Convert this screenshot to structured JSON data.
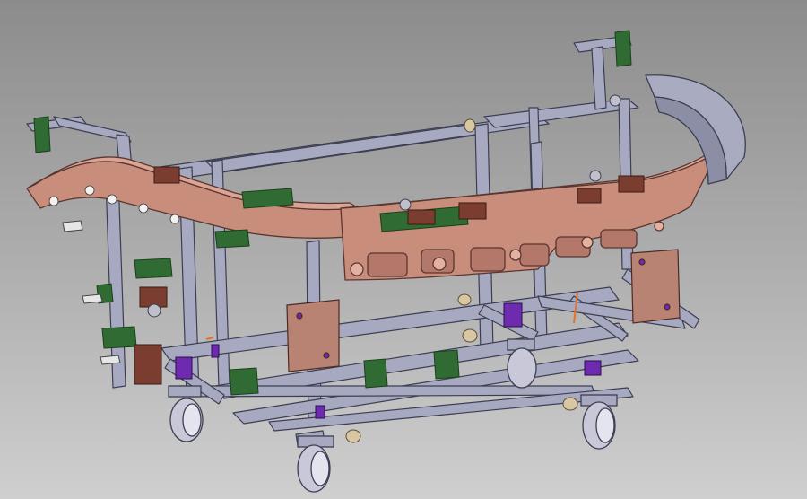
{
  "scene": {
    "background_top": "#8c8c8c",
    "background_bottom": "#cfcfcf",
    "frame_color": "#a7a9c0",
    "frame_edge": "#3c3e52",
    "part_color": "#c98d7c",
    "part_edge": "#5a3630",
    "clamp_color": "#2f6b32",
    "clamp_dark": "#1c3f1e",
    "block_color": "#7a3d2f",
    "locator_plate_color": "#b98373",
    "purple_color": "#6e2bb0",
    "wheel_color": "#c8c8d8",
    "pin_color": "#d9c7a3",
    "accent_orange": "#e8702a"
  }
}
